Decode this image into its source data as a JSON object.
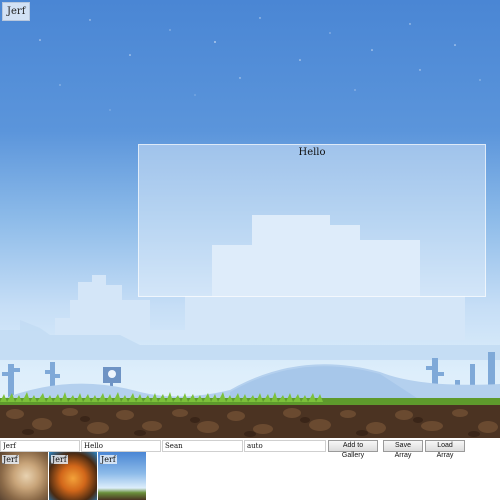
{
  "scene": {
    "title_chip": "Jerf",
    "overlay_text": "Hello"
  },
  "controls": {
    "field_1": "Jerf",
    "field_2": "Hello",
    "field_3": "Sean",
    "field_4": "auto",
    "add_to_gallery": "Add to Gallery",
    "save_array": "Save Array",
    "load_array": "Load Array"
  },
  "gallery": {
    "items": [
      {
        "label": "Jerf"
      },
      {
        "label": "Jerf"
      },
      {
        "label": "Jerf"
      }
    ]
  }
}
